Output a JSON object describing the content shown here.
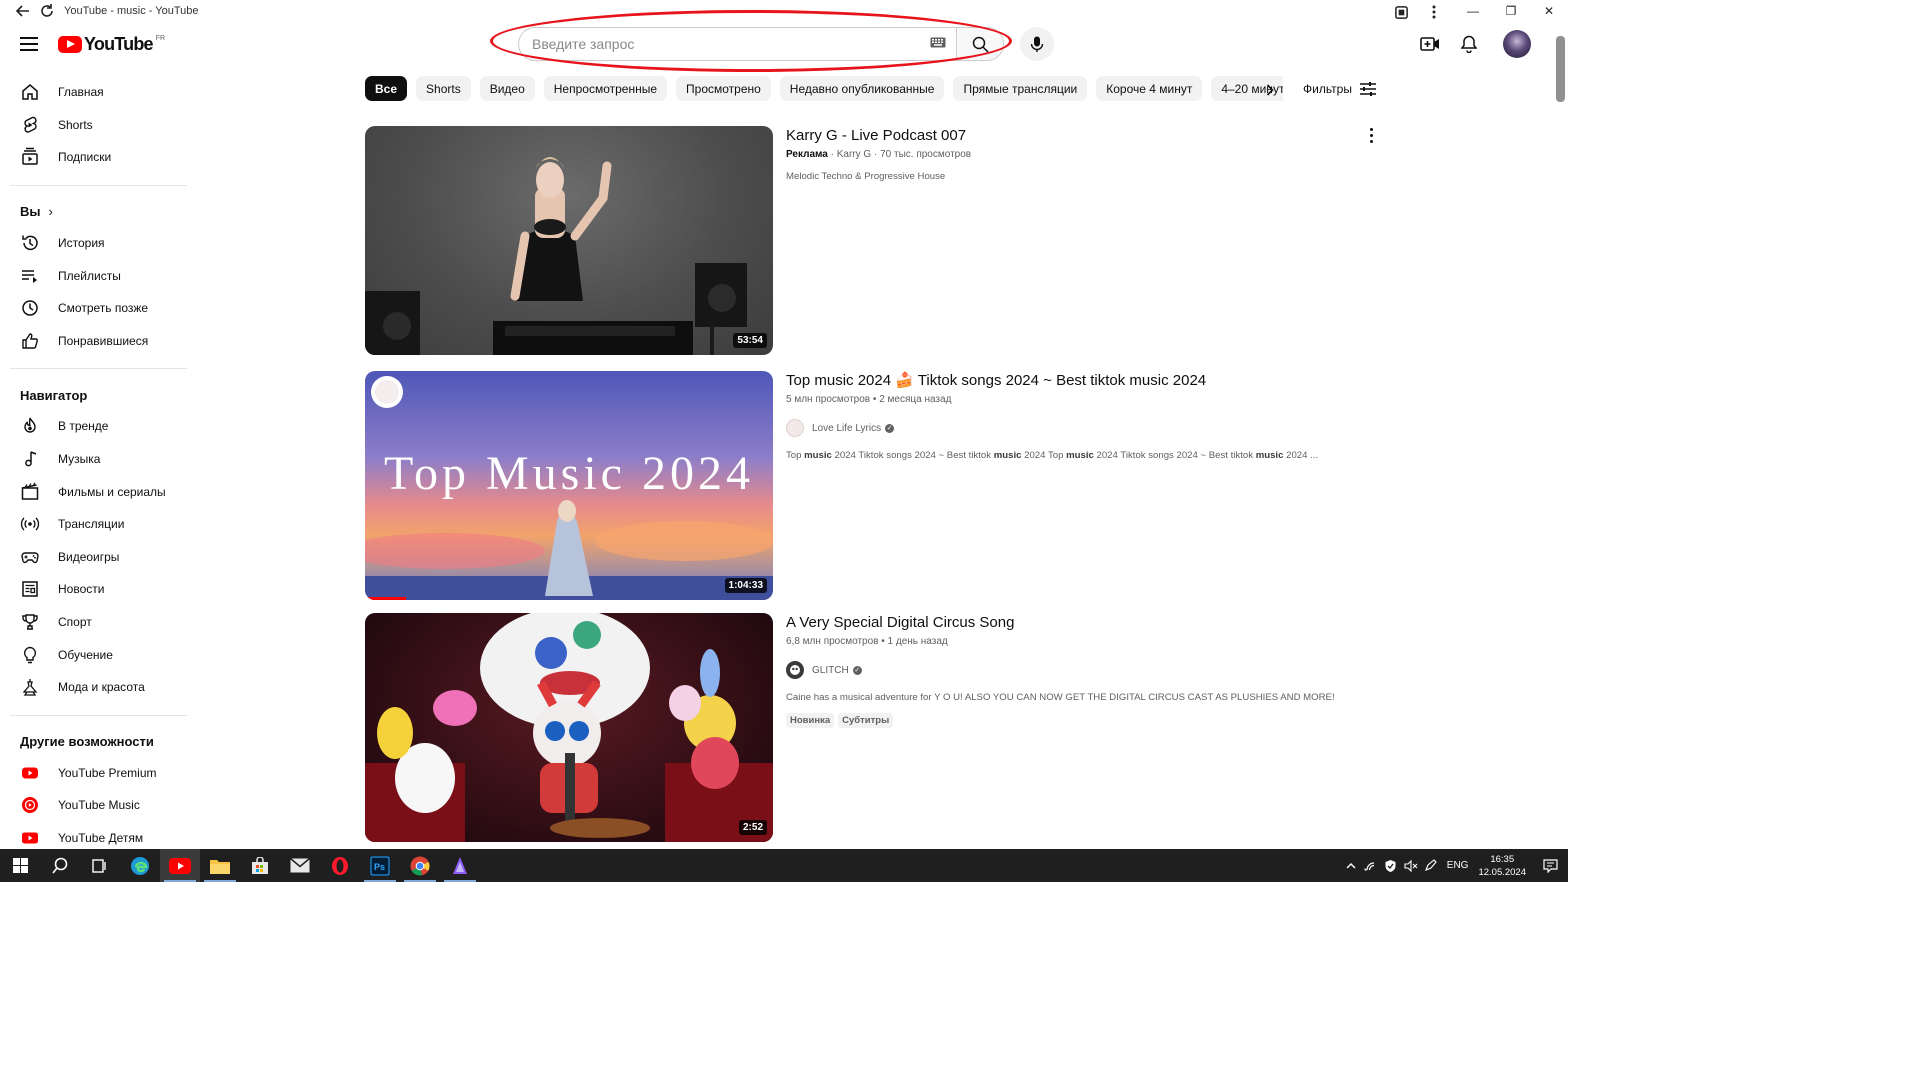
{
  "window": {
    "title": "YouTube - music - YouTube"
  },
  "masthead": {
    "logo_text": "YouTube",
    "country_code": "FR",
    "search_placeholder": "Введите запрос",
    "search_value": ""
  },
  "sidebar": {
    "main": [
      {
        "label": "Главная",
        "icon": "home-icon"
      },
      {
        "label": "Shorts",
        "icon": "shorts-icon"
      },
      {
        "label": "Подписки",
        "icon": "subscriptions-icon"
      }
    ],
    "you_heading": "Вы",
    "you": [
      {
        "label": "История",
        "icon": "history-icon"
      },
      {
        "label": "Плейлисты",
        "icon": "playlists-icon"
      },
      {
        "label": "Смотреть позже",
        "icon": "watch-later-icon"
      },
      {
        "label": "Понравившиеся",
        "icon": "like-icon"
      }
    ],
    "explore_heading": "Навигатор",
    "explore": [
      {
        "label": "В тренде",
        "icon": "trending-icon"
      },
      {
        "label": "Музыка",
        "icon": "music-icon"
      },
      {
        "label": "Фильмы и сериалы",
        "icon": "movies-icon"
      },
      {
        "label": "Трансляции",
        "icon": "live-icon"
      },
      {
        "label": "Видеоигры",
        "icon": "gaming-icon"
      },
      {
        "label": "Новости",
        "icon": "news-icon"
      },
      {
        "label": "Спорт",
        "icon": "sports-icon"
      },
      {
        "label": "Обучение",
        "icon": "learning-icon"
      },
      {
        "label": "Мода и красота",
        "icon": "fashion-icon"
      }
    ],
    "more_heading": "Другие возможности",
    "more": [
      {
        "label": "YouTube Premium",
        "icon": "youtube-premium-icon"
      },
      {
        "label": "YouTube Music",
        "icon": "youtube-music-icon"
      },
      {
        "label": "YouTube Детям",
        "icon": "youtube-kids-icon"
      }
    ]
  },
  "chips": [
    "Все",
    "Shorts",
    "Видео",
    "Непросмотренные",
    "Просмотрено",
    "Недавно опубликованные",
    "Прямые трансляции",
    "Короче 4 минут",
    "4–20 минут"
  ],
  "filters_label": "Фильтры",
  "videos": [
    {
      "title": "Karry G - Live Podcast 007",
      "ad_label": "Реклама",
      "channel": "Karry G",
      "views": "70 тыс. просмотров",
      "description": "Melodic Techno & Progressive House",
      "duration": "53:54"
    },
    {
      "title": "Top music 2024 🍰 Tiktok songs 2024 ~ Best tiktok music 2024",
      "views": "5 млн просмотров",
      "age": "2 месяца назад",
      "channel": "Love Life Lyrics",
      "description_parts": [
        "Top ",
        "music",
        " 2024 Tiktok songs 2024 ~ Best tiktok ",
        "music",
        " 2024 Top ",
        "music",
        " 2024 Tiktok songs 2024 ~ Best tiktok ",
        "music",
        " 2024 ..."
      ],
      "duration": "1:04:33",
      "thumb_text": "Top Music 2024",
      "watch_progress": 0.1
    },
    {
      "title": "A Very Special Digital Circus Song",
      "views": "6,8 млн просмотров",
      "age": "1 день назад",
      "channel": "GLITCH",
      "description": "Caine has a musical adventure for Y O U! ALSO YOU CAN NOW GET THE DIGITAL CIRCUS CAST AS PLUSHIES AND MORE!",
      "badges": [
        "Новинка",
        "Субтитры"
      ],
      "duration": "2:52"
    }
  ],
  "taskbar": {
    "language": "ENG",
    "time": "16:35",
    "date": "12.05.2024"
  },
  "colors": {
    "accent": "#ff0000",
    "annotation": "#e8141c"
  }
}
